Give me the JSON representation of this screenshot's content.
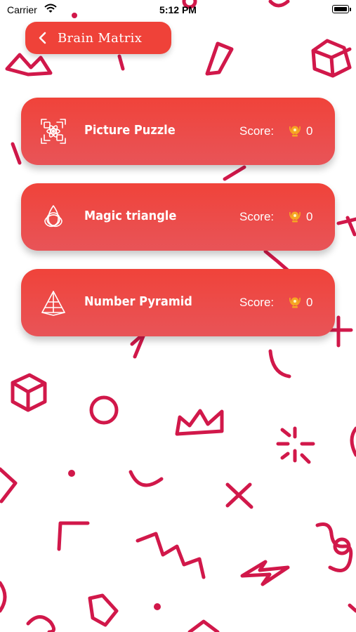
{
  "status_bar": {
    "carrier": "Carrier",
    "time": "5:12 PM"
  },
  "header": {
    "back_label": "Brain Matrix"
  },
  "games": [
    {
      "title": "Picture Puzzle",
      "score_label": "Score:",
      "score": "0",
      "icon": "picture-puzzle-icon"
    },
    {
      "title": "Magic triangle",
      "score_label": "Score:",
      "score": "0",
      "icon": "magic-triangle-icon"
    },
    {
      "title": "Number Pyramid",
      "score_label": "Score:",
      "score": "0",
      "icon": "number-pyramid-icon"
    }
  ],
  "colors": {
    "card": "#ef4239",
    "pattern": "#d1184a",
    "trophy": "#f5a623"
  }
}
